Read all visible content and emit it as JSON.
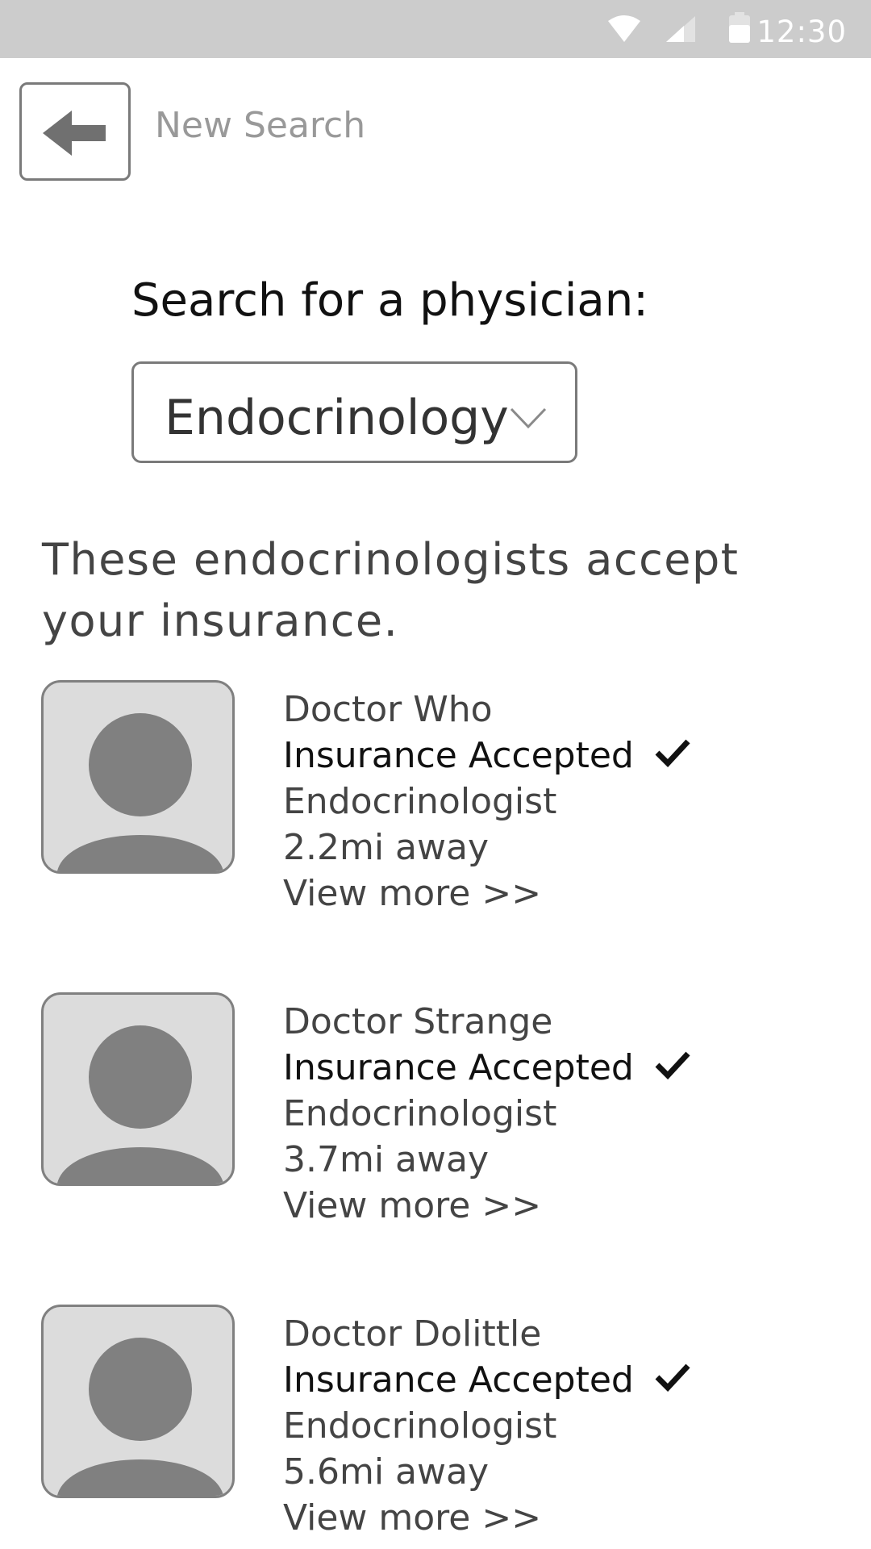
{
  "status_bar": {
    "time": "12:30"
  },
  "header": {
    "title": "New Search"
  },
  "search": {
    "label": "Search for a physician:",
    "selected": "Endocrinology"
  },
  "results": {
    "heading": "These endocrinologists accept your insurance.",
    "doctors": [
      {
        "name": "Doctor Who",
        "insurance": "Insurance Accepted",
        "specialty": "Endocrinologist",
        "distance": "2.2mi away",
        "link": "View more >>"
      },
      {
        "name": "Doctor Strange",
        "insurance": "Insurance Accepted",
        "specialty": "Endocrinologist",
        "distance": "3.7mi away",
        "link": "View more >>"
      },
      {
        "name": "Doctor Dolittle",
        "insurance": "Insurance Accepted",
        "specialty": "Endocrinologist",
        "distance": "5.6mi away",
        "link": "View more >>"
      }
    ]
  },
  "icons": {
    "wifi": "wifi-icon",
    "signal": "signal-icon",
    "battery": "battery-icon",
    "back": "back-arrow-icon",
    "dropdown": "chevron-down-icon",
    "check": "checkmark-icon",
    "avatar": "person-icon"
  },
  "colors": {
    "status_bar": "#cccccc",
    "avatar_bg": "#dcdcdc",
    "avatar_figure": "#808080"
  }
}
